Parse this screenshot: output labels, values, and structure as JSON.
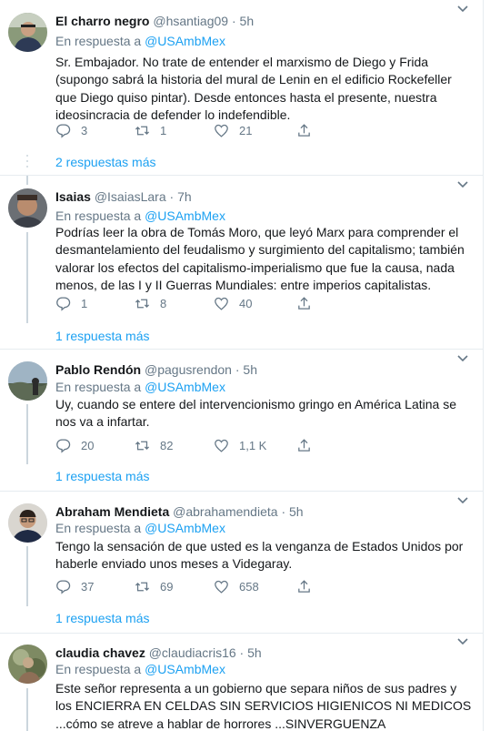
{
  "reply_prefix": "En respuesta a",
  "tweets": [
    {
      "name": "El charro negro",
      "handle": "@hsantiag09",
      "time": "5h",
      "reply_to": "@USAmbMex",
      "text": "Sr. Embajador. No trate de entender el marxismo de Diego y Frida (supongo sabrá la historia del mural de Lenin en el edificio Rockefeller que Diego quiso pintar). Desde entonces hasta el presente, nuestra ideosincracia de defender lo indefendible.",
      "replies": "3",
      "retweets": "1",
      "likes": "21",
      "more": "2 respuestas más"
    },
    {
      "name": "Isaias",
      "handle": "@IsaiasLara",
      "time": "7h",
      "reply_to": "@USAmbMex",
      "text": "Podrías leer la obra de Tomás Moro, que leyó Marx para comprender el desmantelamiento del feudalismo y surgimiento del capitalismo; también valorar los efectos del capitalismo-imperialismo que fue la causa, nada menos, de las I y II Guerras Mundiales: entre imperios capitalistas.",
      "replies": "1",
      "retweets": "8",
      "likes": "40",
      "more": "1 respuesta más"
    },
    {
      "name": "Pablo Rendón",
      "handle": "@pagusrendon",
      "time": "5h",
      "reply_to": "@USAmbMex",
      "text": "Uy, cuando se entere del intervencionismo gringo en América Latina se nos va a infartar.",
      "replies": "20",
      "retweets": "82",
      "likes": "1,1 K",
      "more": "1 respuesta más"
    },
    {
      "name": "Abraham Mendieta",
      "handle": "@abrahamendieta",
      "time": "5h",
      "reply_to": "@USAmbMex",
      "text": "Tengo la sensación de que usted es la venganza de Estados Unidos por haberle enviado unos meses a Videgaray.",
      "replies": "37",
      "retweets": "69",
      "likes": "658",
      "more": "1 respuesta más"
    },
    {
      "name": "claudia chavez",
      "handle": "@claudiacris16",
      "time": "5h",
      "reply_to": "@USAmbMex",
      "text": "Este señor representa a un gobierno que separa niños de sus padres y los ENCIERRA EN CELDAS SIN SERVICIOS HIGIENICOS NI MEDICOS ...cómo se atreve a hablar de horrores ...SINVERGUENZA"
    }
  ],
  "icons": {
    "reply": "reply-icon",
    "retweet": "retweet-icon",
    "like": "like-icon",
    "share": "share-icon",
    "caret": "chevron-down-icon"
  },
  "colors": {
    "link": "#1da1f2",
    "secondary_text": "#657786",
    "border": "#e6ecf0"
  }
}
